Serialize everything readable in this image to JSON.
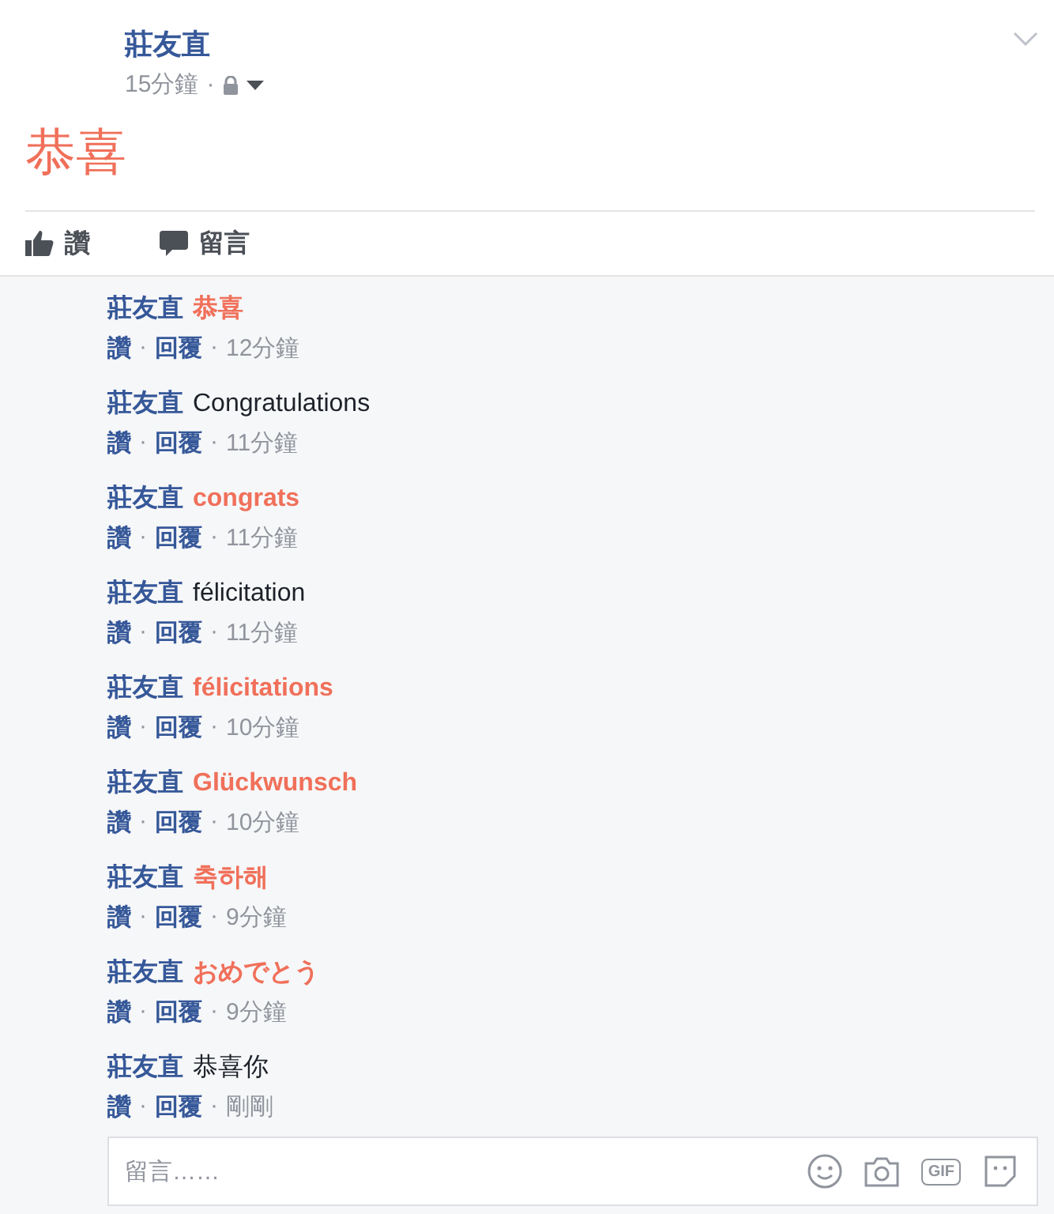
{
  "post": {
    "author": "莊友直",
    "time": "15分鐘",
    "separator": "·",
    "message": "恭喜"
  },
  "actions": [
    {
      "kind": "like",
      "label": "讚"
    },
    {
      "kind": "comment",
      "label": "留言"
    }
  ],
  "comments": [
    {
      "author": "莊友直",
      "text": "恭喜",
      "highlighted": true,
      "like": "讚",
      "reply": "回覆",
      "time": "12分鐘",
      "separators": [
        "·",
        "·"
      ]
    },
    {
      "author": "莊友直",
      "text": "Congratulations",
      "highlighted": false,
      "like": "讚",
      "reply": "回覆",
      "time": "11分鐘",
      "separators": [
        "·",
        "·"
      ]
    },
    {
      "author": "莊友直",
      "text": "congrats",
      "highlighted": true,
      "like": "讚",
      "reply": "回覆",
      "time": "11分鐘",
      "separators": [
        "·",
        "·"
      ]
    },
    {
      "author": "莊友直",
      "text": "félicitation",
      "highlighted": false,
      "like": "讚",
      "reply": "回覆",
      "time": "11分鐘",
      "separators": [
        "·",
        "·"
      ]
    },
    {
      "author": "莊友直",
      "text": "félicitations",
      "highlighted": true,
      "like": "讚",
      "reply": "回覆",
      "time": "10分鐘",
      "separators": [
        "·",
        "·"
      ]
    },
    {
      "author": "莊友直",
      "text": "Glückwunsch",
      "highlighted": true,
      "like": "讚",
      "reply": "回覆",
      "time": "10分鐘",
      "separators": [
        "·",
        "·"
      ]
    },
    {
      "author": "莊友直",
      "text": "축하해",
      "highlighted": true,
      "like": "讚",
      "reply": "回覆",
      "time": "9分鐘",
      "separators": [
        "·",
        "·"
      ]
    },
    {
      "author": "莊友直",
      "text": "おめでとう",
      "highlighted": true,
      "like": "讚",
      "reply": "回覆",
      "time": "9分鐘",
      "separators": [
        "·",
        "·"
      ]
    },
    {
      "author": "莊友直",
      "text": "恭喜你",
      "highlighted": false,
      "like": "讚",
      "reply": "回覆",
      "time": "剛剛",
      "separators": [
        "·",
        "·"
      ]
    }
  ],
  "composer": {
    "placeholder": "留言……",
    "gif_label": "GIF"
  }
}
